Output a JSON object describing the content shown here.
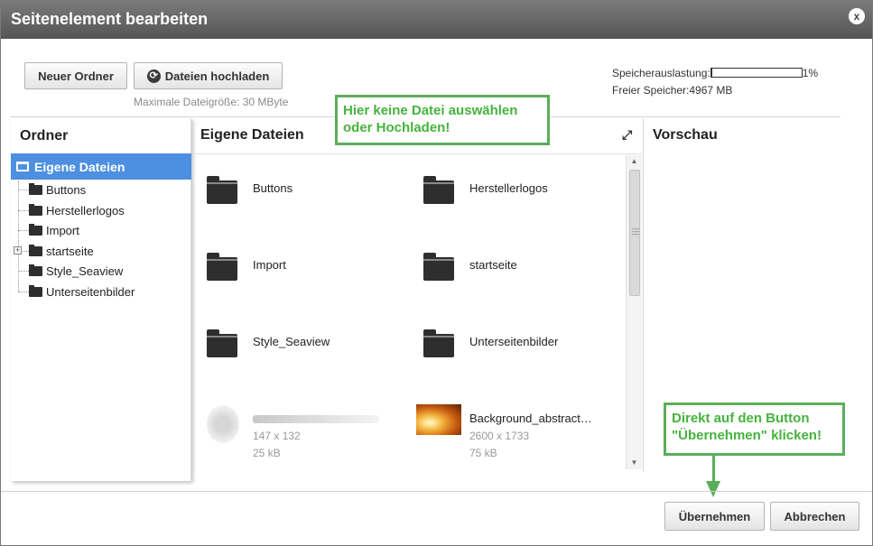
{
  "dialog": {
    "title": "Seitenelement bearbeiten",
    "close_label": "x"
  },
  "toolbar": {
    "new_folder_label": "Neuer Ordner",
    "upload_label": "Dateien hochladen",
    "upload_icon": "upload-refresh-icon",
    "max_size_text": "Maximale Dateigröße: 30 MByte"
  },
  "storage": {
    "usage_label": "Speicherauslastung:",
    "usage_fraction": 0.01,
    "usage_percent_text": "1%",
    "free_label": "Freier Speicher:",
    "free_value": "4967 MB"
  },
  "sidebar": {
    "heading": "Ordner",
    "root": {
      "label": "Eigene Dateien",
      "icon": "root-folder-icon"
    },
    "items": [
      {
        "label": "Buttons",
        "expandable": false
      },
      {
        "label": "Herstellerlogos",
        "expandable": false
      },
      {
        "label": "Import",
        "expandable": false
      },
      {
        "label": "startseite",
        "expandable": true
      },
      {
        "label": "Style_Seaview",
        "expandable": false
      },
      {
        "label": "Unterseitenbilder",
        "expandable": false
      }
    ]
  },
  "main": {
    "heading": "Eigene Dateien",
    "expand_icon": "expand-icon",
    "folders": [
      {
        "label": "Buttons"
      },
      {
        "label": "Herstellerlogos"
      },
      {
        "label": "Import"
      },
      {
        "label": "startseite"
      },
      {
        "label": "Style_Seaview"
      },
      {
        "label": "Unterseitenbilder"
      }
    ],
    "files": [
      {
        "name": "",
        "dimensions": "147 x 132",
        "size": "25 kB"
      },
      {
        "name": "Background_abstract…",
        "dimensions": "2600 x 1733",
        "size": "75 kB"
      }
    ]
  },
  "preview": {
    "heading": "Vorschau"
  },
  "annotations": {
    "top_note": [
      "Hier keine Datei auswählen",
      "oder Hochladen!"
    ],
    "bottom_note": [
      "Direkt auf den Button",
      "\"Übernehmen\" klicken!"
    ],
    "color": "#45b33c"
  },
  "footer": {
    "apply_label": "Übernehmen",
    "cancel_label": "Abbrechen"
  },
  "colors": {
    "titlebar": "#666666",
    "selection": "#4d8fe0",
    "annotation_border": "#5aae5a"
  }
}
